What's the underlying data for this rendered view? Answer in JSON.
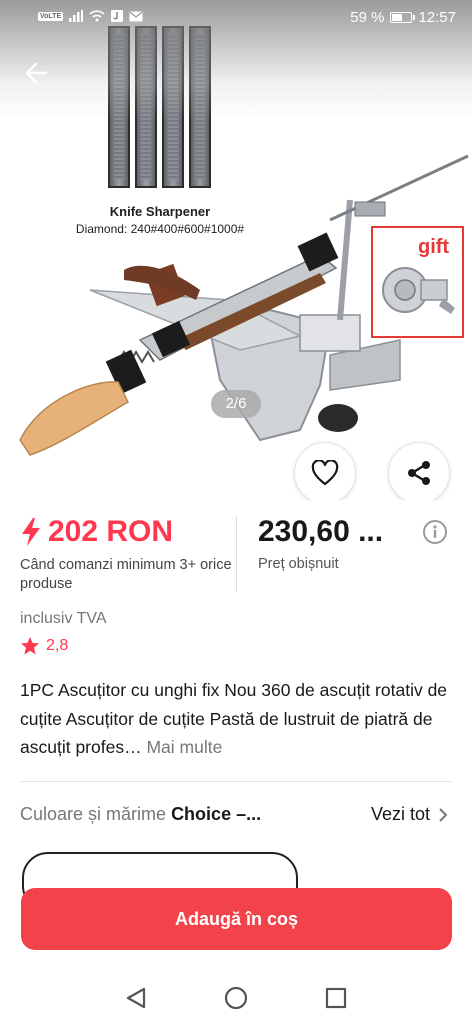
{
  "status_bar": {
    "network": "VoLTE",
    "battery": "59 %",
    "battery_fraction": 0.59,
    "time": "12:57"
  },
  "gallery": {
    "stone_caption_title": "Knife Sharpener",
    "stone_caption_subtitle": "Diamond: 240#400#600#1000#",
    "gift_label": "gift",
    "page_indicator": "2/6"
  },
  "pricing": {
    "sale_price": "202 RON",
    "sale_note": "Când comanzi minimum 3+ orice produse",
    "regular_price": "230,60 ...",
    "regular_label": "Preț obișnuit",
    "vat_note": "inclusiv TVA",
    "rating": "2,8"
  },
  "product": {
    "title": "1PC Ascuțitor cu unghi fix Nou 360 de ascuțit rotativ de cuțite Ascuțitor de cuțite Pastă de lustruit de piatră de ascuțit profes…",
    "more_link": "Mai multe"
  },
  "variants": {
    "label": "Culoare și mărime",
    "value": "Choice –...",
    "view_all": "Vezi tot"
  },
  "actions": {
    "add_to_cart": "Adaugă în coș"
  },
  "colors": {
    "accent": "#fd384f",
    "cart_button": "#f3434a"
  },
  "icons": {
    "back": "back-arrow-icon",
    "favorite": "heart-icon",
    "share": "share-icon",
    "info": "info-icon",
    "price": "lightning-icon",
    "rating": "star-icon",
    "chevron": "chevron-right-icon"
  }
}
